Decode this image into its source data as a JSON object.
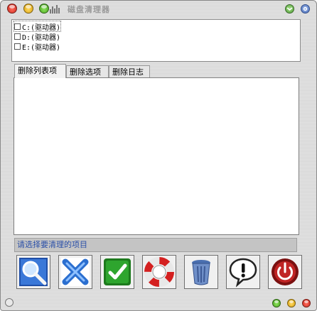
{
  "window": {
    "title": "磁盘清理器",
    "colors": {
      "close": "#e0302a",
      "minimize": "#f2b516",
      "zoom": "#5cc42a",
      "status_text": "#2a4fa8"
    }
  },
  "drives": [
    {
      "label": "C:(驱动器)",
      "checked": false,
      "selected": true
    },
    {
      "label": "D:(驱动器)",
      "checked": false,
      "selected": false
    },
    {
      "label": "E:(驱动器)",
      "checked": false,
      "selected": false
    }
  ],
  "tabs": [
    {
      "label": "删除列表项",
      "active": true
    },
    {
      "label": "删除选项",
      "active": false
    },
    {
      "label": "删除日志",
      "active": false
    }
  ],
  "status": {
    "text": "请选择要清理的项目"
  },
  "toolbar": {
    "buttons": [
      {
        "icon": "magnifier-icon"
      },
      {
        "icon": "blue-x-icon"
      },
      {
        "icon": "green-check-icon"
      },
      {
        "icon": "lifebuoy-icon"
      },
      {
        "icon": "recycle-bin-icon"
      },
      {
        "icon": "exclamation-icon"
      },
      {
        "icon": "power-icon"
      }
    ]
  }
}
